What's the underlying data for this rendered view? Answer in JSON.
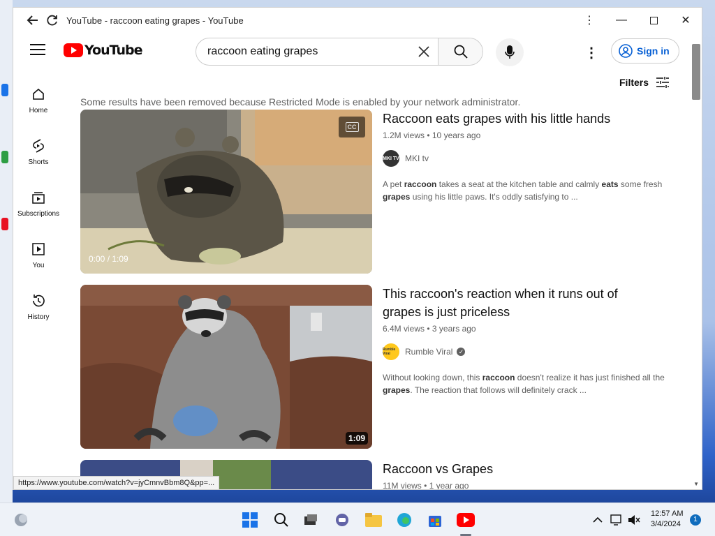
{
  "window": {
    "title": "YouTube - raccoon eating grapes - YouTube"
  },
  "masthead": {
    "logo_text": "YouTube",
    "search_value": "raccoon eating grapes",
    "signin_label": "Sign in"
  },
  "sidebar": {
    "items": [
      {
        "label": "Home",
        "icon": "home-icon"
      },
      {
        "label": "Shorts",
        "icon": "shorts-icon"
      },
      {
        "label": "Subscriptions",
        "icon": "subscriptions-icon"
      },
      {
        "label": "You",
        "icon": "you-icon"
      },
      {
        "label": "History",
        "icon": "history-icon"
      }
    ]
  },
  "filters_label": "Filters",
  "notice": "Some results have been removed because Restricted Mode is enabled by your network administrator.",
  "results": [
    {
      "title": "Raccoon eats grapes with his little hands",
      "stats": "1.2M views • 10 years ago",
      "channel": "MKI tv",
      "channel_avatar_text": "MKI TV",
      "desc_parts": [
        "A pet ",
        "raccoon",
        " takes a seat at the kitchen table and calmly ",
        "eats",
        " some fresh ",
        "grapes",
        " using his little paws. It's oddly satisfying to ..."
      ],
      "progress": "0:00 / 1:09",
      "cc_label": "CC"
    },
    {
      "title": "This raccoon's reaction when it runs out of grapes is just priceless",
      "stats": "6.4M views • 3 years ago",
      "channel": "Rumble Viral",
      "channel_avatar_text": "Rumble Viral",
      "verified_mark": "✓",
      "desc_parts": [
        "Without looking down, this ",
        "raccoon",
        " doesn't realize it has just finished all the ",
        "grapes",
        ". The reaction that follows will definitely crack ..."
      ],
      "duration": "1:09"
    },
    {
      "title": "Raccoon vs Grapes",
      "stats": "11M views • 1 year ago"
    }
  ],
  "status_url": "https://www.youtube.com/watch?v=jyCmnvBbm8Q&pp=...",
  "taskbar": {
    "time": "12:57 AM",
    "date": "3/4/2024",
    "notifications": "1"
  },
  "colors": {
    "brand_red": "#ff0000",
    "link_blue": "#065fd4"
  }
}
